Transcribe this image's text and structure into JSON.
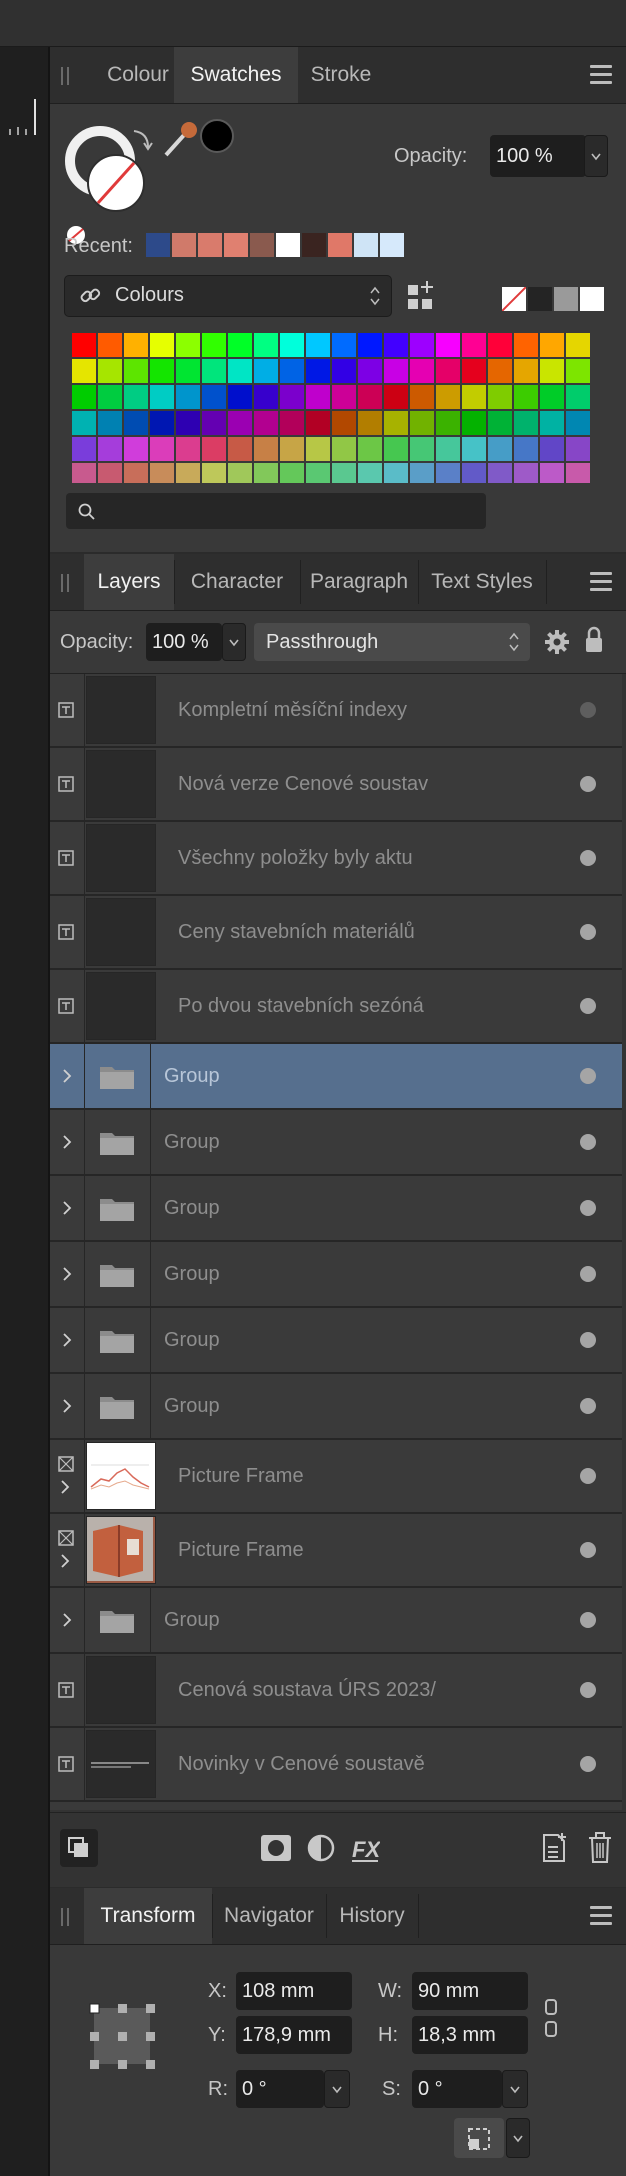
{
  "colors": {
    "panel_bg": "#393939",
    "tabbar_bg": "#2e2e2e",
    "selection": "#566f8e",
    "recent_swatches": [
      "#2d4a8a",
      "#d07a6a",
      "#d97b6c",
      "#e08070",
      "#8a5a4e",
      "#ffffff",
      "#3a2420",
      "#e07868",
      "#cfe4f6",
      "#d6e9fb"
    ],
    "quick_swatches": [
      "#242424",
      "#9a9a9a",
      "#ffffff"
    ],
    "palette_rows": [
      [
        "#ff0000",
        "#ff5b00",
        "#ffb100",
        "#e6ff00",
        "#8cff00",
        "#31ff00",
        "#00ff27",
        "#00ff82",
        "#00ffdb",
        "#00c8ff",
        "#006bff",
        "#0018ff",
        "#4200ff",
        "#9d00ff",
        "#f700ff",
        "#ff0093",
        "#ff0039",
        "#ff6300",
        "#ffa700",
        "#e5d600"
      ],
      [
        "#e5e500",
        "#a6e500",
        "#5de500",
        "#14e500",
        "#00e531",
        "#00e57c",
        "#00e5c5",
        "#00aee5",
        "#0063e5",
        "#0018e5",
        "#3200e5",
        "#7d00e5",
        "#c800e5",
        "#e500b2",
        "#e50068",
        "#e5001d",
        "#e56600",
        "#e5a600",
        "#c9e500",
        "#7de500"
      ],
      [
        "#00cc00",
        "#00cc40",
        "#00cc83",
        "#00ccc4",
        "#0095cc",
        "#0051cc",
        "#000fcc",
        "#3700cc",
        "#7b00cc",
        "#bf00cc",
        "#cc0097",
        "#cc0055",
        "#cc0013",
        "#cc5a00",
        "#cc9c00",
        "#c2cc00",
        "#7fcc00",
        "#3ccc00",
        "#00cc28",
        "#00cc6b"
      ],
      [
        "#00b2b2",
        "#0081b2",
        "#004cb2",
        "#0017b2",
        "#2e00b2",
        "#6400b2",
        "#9b00b2",
        "#b20090",
        "#b2005a",
        "#b20024",
        "#b24800",
        "#b27e00",
        "#a7b200",
        "#71b200",
        "#3bb200",
        "#04b200",
        "#00b236",
        "#00b26c",
        "#00b2a3",
        "#0087b2"
      ],
      [
        "#7a3ddb",
        "#a53ddb",
        "#d03ddb",
        "#db3dba",
        "#db3d8f",
        "#db3d64",
        "#c75a46",
        "#c78046",
        "#c7a546",
        "#b7c746",
        "#91c746",
        "#6cc746",
        "#46c750",
        "#46c775",
        "#46c79b",
        "#46c2c7",
        "#469dc7",
        "#4677c7",
        "#6146c7",
        "#8746c7"
      ],
      [
        "#c85a8e",
        "#c85a70",
        "#c86e5a",
        "#c88c5a",
        "#c8aa5a",
        "#bec85a",
        "#a0c85a",
        "#82c85a",
        "#64c85a",
        "#5ac872",
        "#5ac890",
        "#5ac8ae",
        "#5abcc8",
        "#5a9ec8",
        "#5a80c8",
        "#625ac8",
        "#805ac8",
        "#9e5ac8",
        "#bc5ac8",
        "#c85aaa"
      ]
    ]
  },
  "swatches_panel": {
    "tabs": [
      "Colour",
      "Swatches",
      "Stroke"
    ],
    "active_tab": "Swatches",
    "opacity_label": "Opacity:",
    "opacity_value": "100 %",
    "recent_label": "Recent:",
    "palette_name": "Colours",
    "search_placeholder": ""
  },
  "layers_panel": {
    "tabs": [
      "Layers",
      "Character",
      "Paragraph",
      "Text Styles"
    ],
    "active_tab": "Layers",
    "opacity_label": "Opacity:",
    "opacity_value": "100 %",
    "blend_mode": "Passthrough",
    "rows": [
      {
        "type": "text",
        "name": "Kompletní měsíční indexy"
      },
      {
        "type": "text",
        "name": "Nová verze Cenové soustav"
      },
      {
        "type": "text",
        "name": "Všechny položky byly aktu"
      },
      {
        "type": "text",
        "name": "Ceny stavebních materiálů"
      },
      {
        "type": "text",
        "name": "Po dvou stavebních sezóná"
      },
      {
        "type": "group",
        "name": "Group"
      },
      {
        "type": "group",
        "name": "Group"
      },
      {
        "type": "group",
        "name": "Group"
      },
      {
        "type": "group",
        "name": "Group"
      },
      {
        "type": "group",
        "name": "Group"
      },
      {
        "type": "group",
        "name": "Group"
      },
      {
        "type": "picture",
        "name": "Picture Frame"
      },
      {
        "type": "picture",
        "name": "Picture Frame"
      },
      {
        "type": "group",
        "name": "Group"
      },
      {
        "type": "text",
        "name": "Cenová soustava ÚRS 2023/"
      },
      {
        "type": "text",
        "name": "Novinky v Cenové soustavě"
      }
    ]
  },
  "transform_panel": {
    "tabs": [
      "Transform",
      "Navigator",
      "History"
    ],
    "active_tab": "Transform",
    "x_label": "X:",
    "x_value": "108 mm",
    "y_label": "Y:",
    "y_value": "178,9 mm",
    "w_label": "W:",
    "w_value": "90 mm",
    "h_label": "H:",
    "h_value": "18,3 mm",
    "r_label": "R:",
    "r_value": "0 °",
    "s_label": "S:",
    "s_value": "0 °"
  }
}
